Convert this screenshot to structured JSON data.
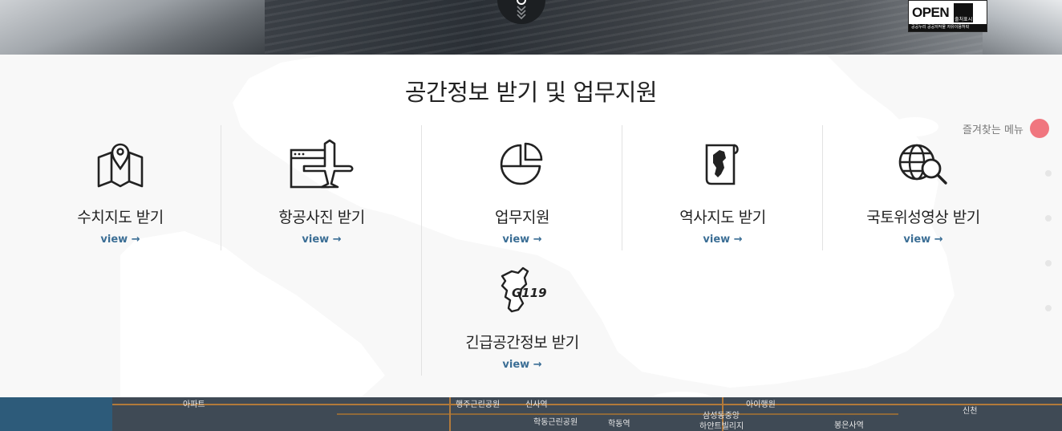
{
  "hero": {
    "open_badge": {
      "word": "OPEN",
      "subtext": "공공누리  공공저작물 자유이용허락",
      "person_caption": "출처표시"
    }
  },
  "section": {
    "title": "공간정보 받기 및 업무지원",
    "view_label": "view →",
    "items": [
      {
        "label": "수치지도 받기",
        "icon": "map-pin-icon"
      },
      {
        "label": "항공사진 받기",
        "icon": "airplane-icon"
      },
      {
        "label": "업무지원",
        "icon": "pie-chart-icon"
      },
      {
        "label": "역사지도 받기",
        "icon": "korea-map-document-icon"
      },
      {
        "label": "국토위성영상 받기",
        "icon": "globe-search-icon"
      },
      {
        "label": "긴급공간정보 받기",
        "icon": "g119-map-icon",
        "icon_text": "G119"
      }
    ]
  },
  "favorites": {
    "label": "즐겨찾는 메뉴"
  },
  "bottom_map": {
    "labels": [
      "아파트",
      "행주근린공원",
      "신사역",
      "학동근린공원",
      "학동역",
      "삼성동중앙",
      "하얀트빌리지",
      "봉은사역",
      "아이행원",
      "신천"
    ]
  },
  "colors": {
    "accent_view": "#3b6e95",
    "favorite_dot": "#f0767f",
    "title_text": "#222222"
  }
}
